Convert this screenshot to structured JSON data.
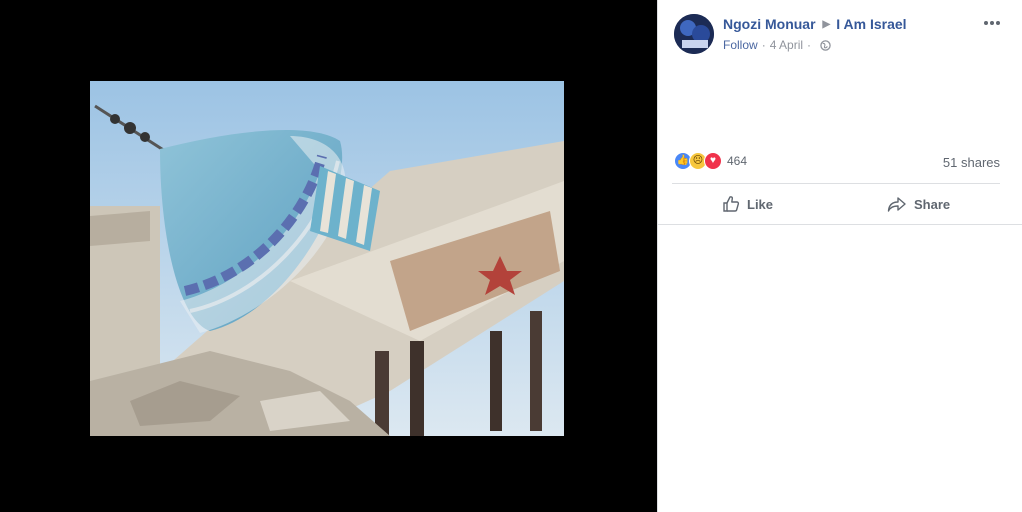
{
  "post": {
    "author": "Ngozi Monuar",
    "group": "I Am Israel",
    "follow_label": "Follow",
    "date": "4 April",
    "reaction_count": "464",
    "shares": "51 shares",
    "actions": {
      "like": "Like",
      "share": "Share"
    },
    "reaction_types": [
      "like-icon",
      "sad-icon",
      "love-icon"
    ]
  },
  "colors": {
    "link_blue": "#365899",
    "muted_text": "#90949c",
    "like_blue": "#4a88f7",
    "love_red": "#f0334c",
    "sad_yellow": "#f7c73e"
  }
}
